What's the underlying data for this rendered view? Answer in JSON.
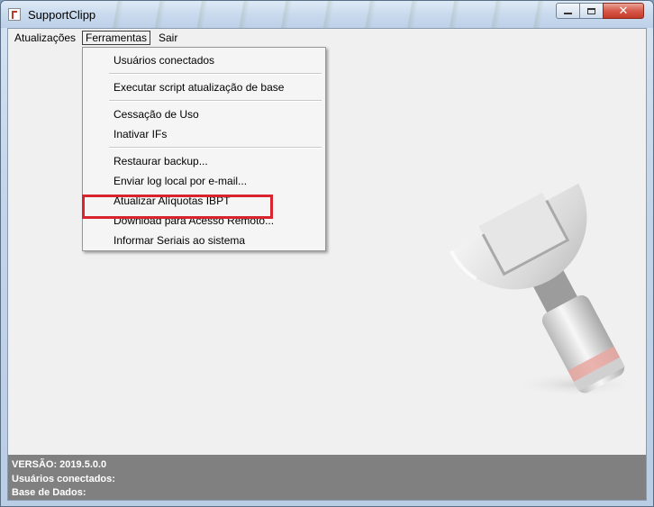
{
  "window": {
    "title": "SupportClipp"
  },
  "menubar": {
    "items": [
      "Atualizações",
      "Ferramentas",
      "Sair"
    ]
  },
  "dropdown": {
    "items": [
      "Usuários conectados",
      "Executar script atualização de base",
      "Cessação de Uso",
      "Inativar IFs",
      "Restaurar backup...",
      "Enviar log local por e-mail...",
      "Atualizar Alíquotas IBPT",
      "Download para Acesso Remoto...",
      "Informar Seriais ao sistema"
    ],
    "highlighted_item": "Informar Seriais ao sistema",
    "highlight_color": "#d9232e"
  },
  "status": {
    "version_label": "VERSÃO: 2019.5.0.0",
    "users_label": "Usuários conectados:",
    "database_label": "Base de Dados:"
  },
  "icons": {
    "app": "app-icon",
    "decor": "wrench-icon"
  }
}
